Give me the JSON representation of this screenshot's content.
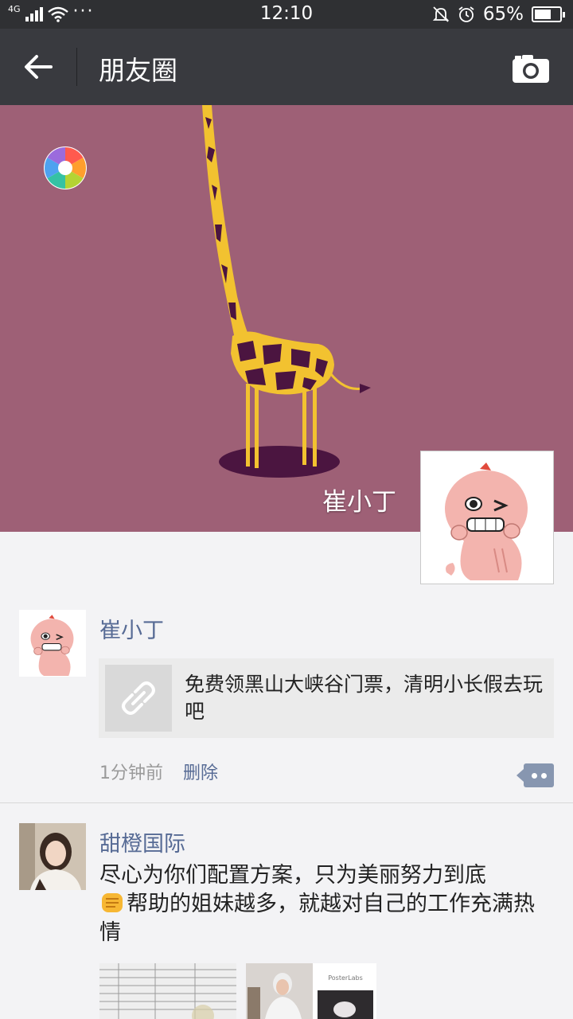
{
  "status_bar": {
    "network": "4G",
    "time": "12:10",
    "battery_text": "65%",
    "battery_level": 0.65,
    "icons": [
      "signal-icon",
      "wifi-icon",
      "more-dots-icon",
      "bell-muted-icon",
      "alarm-icon",
      "battery-icon"
    ]
  },
  "header": {
    "title": "朋友圈",
    "back_icon": "back-arrow-icon",
    "camera_icon": "camera-icon"
  },
  "cover": {
    "owner_name": "崔小丁",
    "colors": {
      "background": "#9e6076",
      "giraffe": "#f2c230",
      "spots": "#4b1540"
    }
  },
  "posts": [
    {
      "author": "崔小丁",
      "share_text": "免费领黑山大峡谷门票，清明小长假去玩吧",
      "time": "1分钟前",
      "delete_label": "删除",
      "thumb_icon": "link-icon"
    },
    {
      "author": "甜橙国际",
      "text_line1": "尽心为你们配置方案，只为美丽努力到底",
      "text_line2": "帮助的姐妹越多，就越对自己的工作充满热情",
      "emoji": "fist-emoji",
      "photo_caption": "PosterLabs"
    }
  ],
  "colors": {
    "accent": "#576b95",
    "titlebar": "#393a3f",
    "statusbar": "#2f3033"
  }
}
